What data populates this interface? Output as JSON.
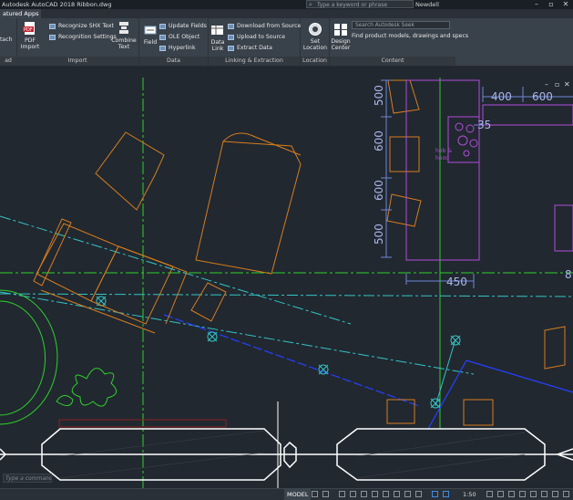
{
  "window": {
    "title": "Autodesk AutoCAD 2018   Ribbon.dwg",
    "search_placeholder": "Type a keyword or phrase",
    "user": "Newdell"
  },
  "tabs": [
    "atured Apps"
  ],
  "ribbon": {
    "partial_panel_label": "ad",
    "import": {
      "title": "Import",
      "attach": "tach",
      "pdf_import": [
        "PDF",
        "Import"
      ],
      "recognize_shx": "Recognize SHX Text",
      "recognition_settings": "Recognition Settings",
      "combine_text": [
        "Combine",
        "Text"
      ]
    },
    "data": {
      "title": "Data",
      "field": "Field",
      "update_fields": "Update Fields",
      "ole_object": "OLE Object",
      "hyperlink": "Hyperlink"
    },
    "linking": {
      "title": "Linking & Extraction",
      "data_link": [
        "Data",
        "Link"
      ],
      "download_source": "Download from Source",
      "upload_source": "Upload to Source",
      "extract_data": "Extract  Data"
    },
    "location": {
      "title": "Location",
      "set_location": [
        "Set",
        "Location"
      ]
    },
    "content": {
      "title": "Content",
      "design_center": [
        "Design",
        "Center"
      ],
      "search_placeholder": "Search Autodesk Seek",
      "find_text": "Find product models, drawings and specs"
    }
  },
  "dimensions": [
    "400",
    "600",
    "500",
    "600",
    "600",
    "500",
    "450",
    "35",
    "8"
  ],
  "labels": {
    "hob": "hob &",
    "hood": "hood"
  },
  "command_prompt": "Type a command",
  "statusbar": {
    "model": "MODEL",
    "scale": "1:50"
  },
  "colors": {
    "background": "#212830",
    "orange": "#d77d1e",
    "green": "#2fd12a",
    "cyan": "#34c4c4",
    "blue": "#2740ff",
    "magenta": "#b24ddb",
    "dim_blue": "#6f86d6"
  }
}
